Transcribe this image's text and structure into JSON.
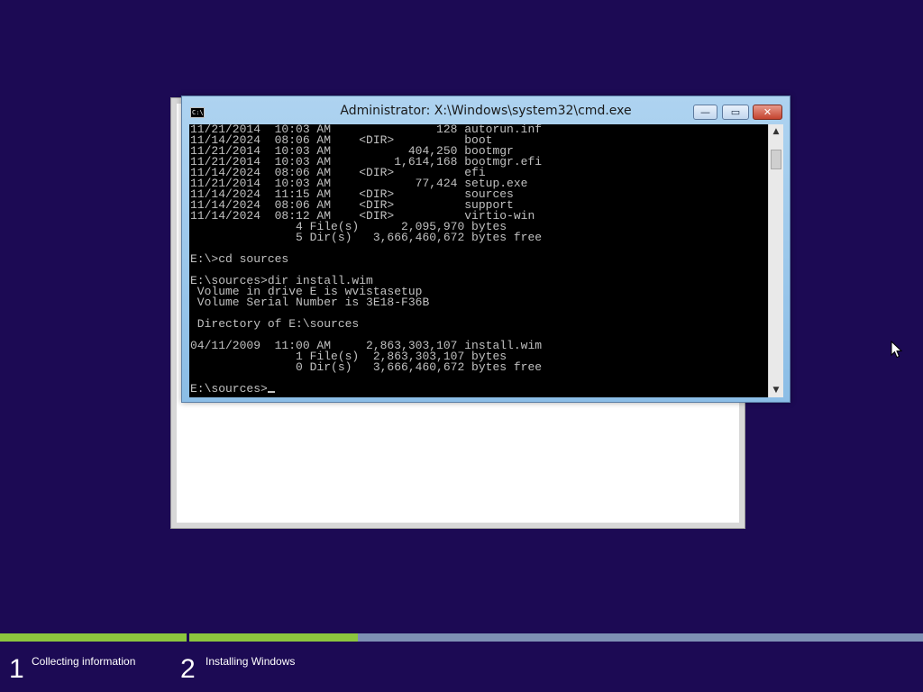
{
  "setup_window": {},
  "cmd_window": {
    "title": "Administrator: X:\\Windows\\system32\\cmd.exe",
    "icon": "C:\\",
    "buttons": {
      "minimize_icon": "minimize-icon",
      "maximize_icon": "maximize-icon",
      "close_icon": "close-icon",
      "minimize_glyph": "—",
      "maximize_glyph": "▭",
      "close_glyph": "✕"
    },
    "console_lines": [
      "11/21/2014  10:03 AM               128 autorun.inf",
      "11/14/2024  08:06 AM    <DIR>          boot",
      "11/21/2014  10:03 AM           404,250 bootmgr",
      "11/21/2014  10:03 AM         1,614,168 bootmgr.efi",
      "11/14/2024  08:06 AM    <DIR>          efi",
      "11/21/2014  10:03 AM            77,424 setup.exe",
      "11/14/2024  11:15 AM    <DIR>          sources",
      "11/14/2024  08:06 AM    <DIR>          support",
      "11/14/2024  08:12 AM    <DIR>          virtio-win",
      "               4 File(s)      2,095,970 bytes",
      "               5 Dir(s)   3,666,460,672 bytes free",
      "",
      "E:\\>cd sources",
      "",
      "E:\\sources>dir install.wim",
      " Volume in drive E is wvistasetup",
      " Volume Serial Number is 3E18-F36B",
      "",
      " Directory of E:\\sources",
      "",
      "04/11/2009  11:00 AM     2,863,303,107 install.wim",
      "               1 File(s)  2,863,303,107 bytes",
      "               0 Dir(s)   3,666,460,672 bytes free",
      "",
      "E:\\sources>"
    ],
    "scrollbar": {
      "up_glyph": "▲",
      "down_glyph": "▼"
    }
  },
  "setup_progress": {
    "colors": {
      "background": "#1c0a54",
      "track": "#7e90b4",
      "fill": "#8cc63e"
    },
    "steps": [
      {
        "number": "1",
        "label": "Collecting information",
        "progress": 1.0
      },
      {
        "number": "2",
        "label": "Installing Windows",
        "progress": 0.23
      }
    ]
  }
}
